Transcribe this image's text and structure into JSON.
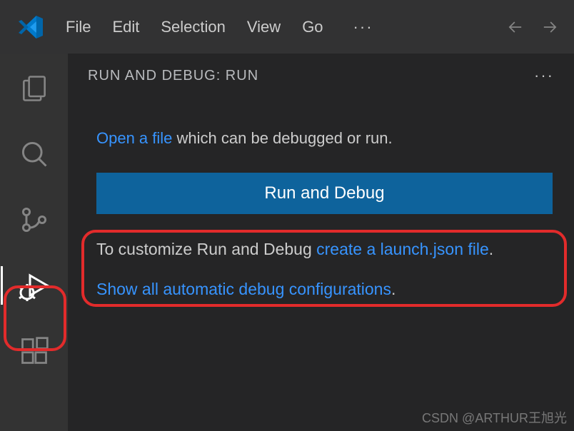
{
  "menubar": {
    "file": "File",
    "edit": "Edit",
    "selection": "Selection",
    "view": "View",
    "go": "Go",
    "ellipsis": "···"
  },
  "sidebar": {
    "header_title": "RUN AND DEBUG: RUN",
    "ellipsis": "···",
    "open_file_link": "Open a file",
    "open_file_rest": " which can be debugged or run.",
    "run_button": "Run and Debug",
    "customize_prefix": "To customize Run and Debug ",
    "customize_link": "create a launch.json file",
    "customize_suffix": ".",
    "show_all_link": "Show all automatic debug configurations",
    "show_all_suffix": "."
  },
  "watermark": "CSDN @ARTHUR王旭光"
}
